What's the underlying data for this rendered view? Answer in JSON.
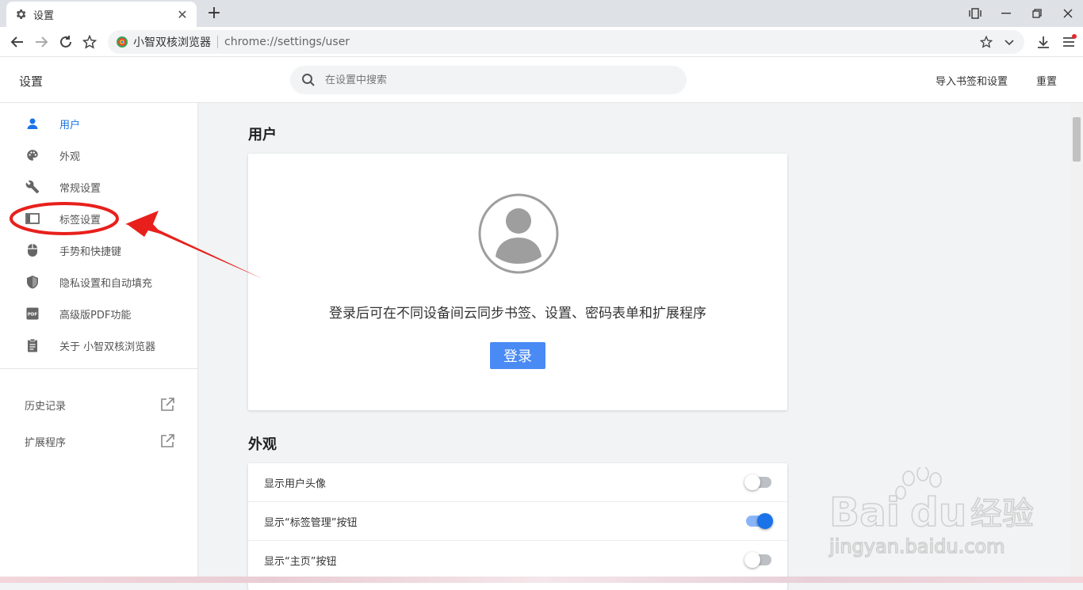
{
  "tab": {
    "title": "设置"
  },
  "address": {
    "brand": "小智双核浏览器",
    "url": "chrome://settings/user"
  },
  "header": {
    "title": "设置",
    "search_placeholder": "在设置中搜索",
    "import_label": "导入书签和设置",
    "reset_label": "重置"
  },
  "sidebar": {
    "items": [
      {
        "label": "用户",
        "icon": "person-icon",
        "active": true
      },
      {
        "label": "外观",
        "icon": "palette-icon"
      },
      {
        "label": "常规设置",
        "icon": "wrench-icon"
      },
      {
        "label": "标签设置",
        "icon": "tab-icon"
      },
      {
        "label": "手势和快捷键",
        "icon": "mouse-icon"
      },
      {
        "label": "隐私设置和自动填充",
        "icon": "shield-icon"
      },
      {
        "label": "高级版PDF功能",
        "icon": "pdf-icon"
      },
      {
        "label": "关于 小智双核浏览器",
        "icon": "clipboard-icon"
      }
    ],
    "links": [
      {
        "label": "历史记录"
      },
      {
        "label": "扩展程序"
      }
    ]
  },
  "main": {
    "user_section": {
      "title": "用户",
      "sync_text": "登录后可在不同设备间云同步书签、设置、密码表单和扩展程序",
      "login_label": "登录"
    },
    "appearance_section": {
      "title": "外观",
      "rows": [
        {
          "label": "显示用户头像",
          "on": false
        },
        {
          "label": "显示“标签管理”按钮",
          "on": true
        },
        {
          "label": "显示“主页”按钮",
          "on": false
        }
      ]
    }
  },
  "watermark": {
    "brand": "Bai",
    "brand2": "du",
    "cn": "经验",
    "url": "jingyan.baidu.com"
  },
  "colors": {
    "accent": "#1a73e8",
    "button": "#4a8af4",
    "annotation": "#e8201c"
  }
}
